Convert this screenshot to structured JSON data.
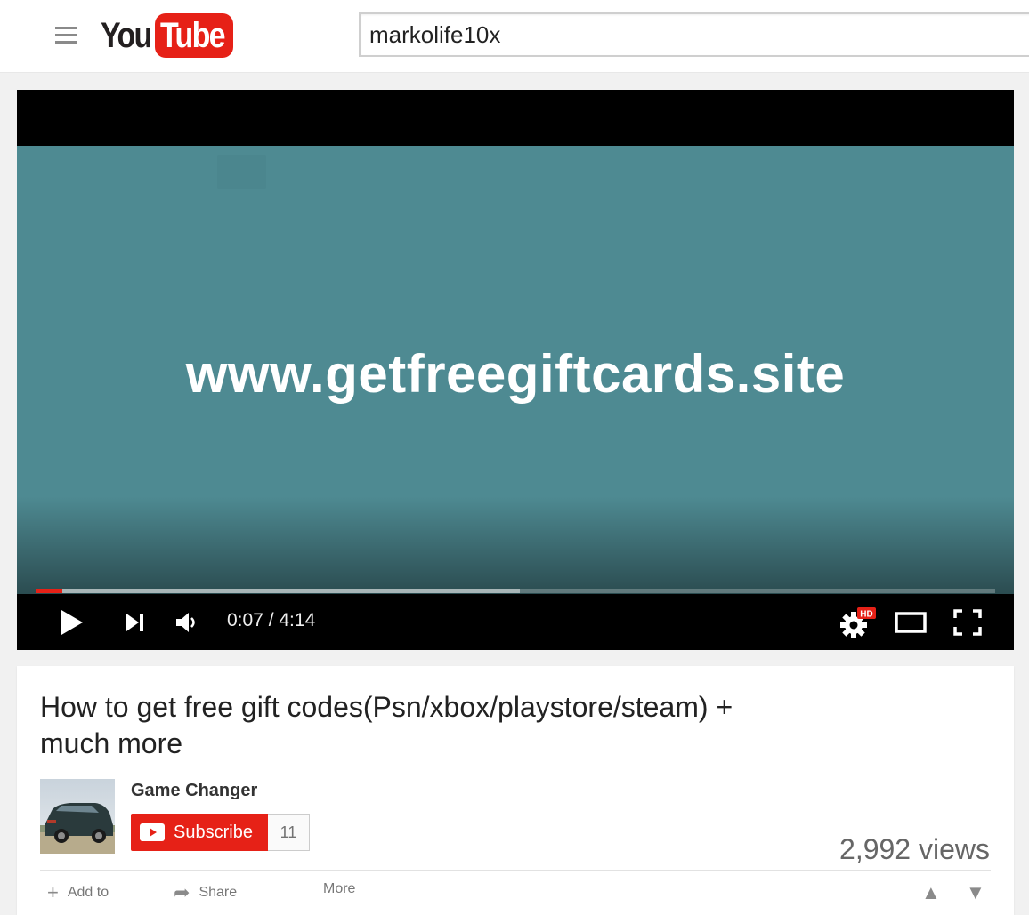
{
  "masthead": {
    "logo_you": "You",
    "logo_tube": "Tube",
    "search_value": "markolife10x",
    "icons": {
      "menu": "hamburger-menu-icon"
    }
  },
  "player": {
    "video_text": "www.getfreegiftcards.site",
    "current_time": "0:07",
    "duration": "4:14",
    "time_display": "0:07 / 4:14",
    "progress_played_fraction": 0.028,
    "progress_loaded_fraction": 0.505,
    "settings_badge": "HD",
    "colors": {
      "video_background": "#4e8a92",
      "progress_played": "#e62117"
    },
    "icons": {
      "play": "play-icon",
      "next": "next-icon",
      "volume": "volume-icon",
      "settings": "gear-icon",
      "theater": "theater-mode-icon",
      "fullscreen": "fullscreen-icon"
    }
  },
  "video_info": {
    "title": "How to get free gift codes(Psn/xbox/playstore/steam) + much more",
    "channel_name": "Game Changer",
    "subscribe_label": "Subscribe",
    "subscriber_count": "11",
    "views": "2,992 views",
    "actions": [
      {
        "label": "Add to",
        "icon": "plus-icon"
      },
      {
        "label": "Share",
        "icon": "share-arrow-icon"
      },
      {
        "label": "More",
        "icon": "more-icon"
      }
    ],
    "colors": {
      "subscribe": "#e62117"
    }
  }
}
